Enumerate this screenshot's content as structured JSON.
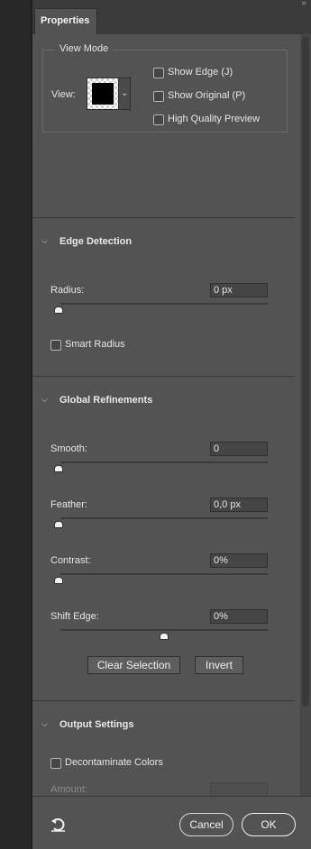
{
  "panel": {
    "tab_label": "Properties",
    "collapse_glyph": "››"
  },
  "view_mode": {
    "legend": "View Mode",
    "view_label": "View:",
    "checkboxes": [
      {
        "label": "Show Edge (J)",
        "checked": false
      },
      {
        "label": "Show Original (P)",
        "checked": false
      },
      {
        "label": "High Quality Preview",
        "checked": false
      }
    ]
  },
  "edge_detection": {
    "title": "Edge Detection",
    "radius": {
      "label": "Radius:",
      "value": "0 px"
    },
    "smart_radius": {
      "label": "Smart Radius",
      "checked": false
    }
  },
  "global_refinements": {
    "title": "Global Refinements",
    "smooth": {
      "label": "Smooth:",
      "value": "0"
    },
    "feather": {
      "label": "Feather:",
      "value": "0,0 px"
    },
    "contrast": {
      "label": "Contrast:",
      "value": "0%"
    },
    "shift_edge": {
      "label": "Shift Edge:",
      "value": "0%"
    },
    "clear_selection": "Clear Selection",
    "invert": "Invert"
  },
  "output_settings": {
    "title": "Output Settings",
    "decontaminate": {
      "label": "Decontaminate Colors",
      "checked": false
    },
    "amount_label": "Amount:"
  },
  "footer": {
    "cancel": "Cancel",
    "ok": "OK"
  },
  "colors": {
    "panel_bg": "#535353",
    "dark_edge": "#282828",
    "accent_white": "#f2f2f2"
  }
}
